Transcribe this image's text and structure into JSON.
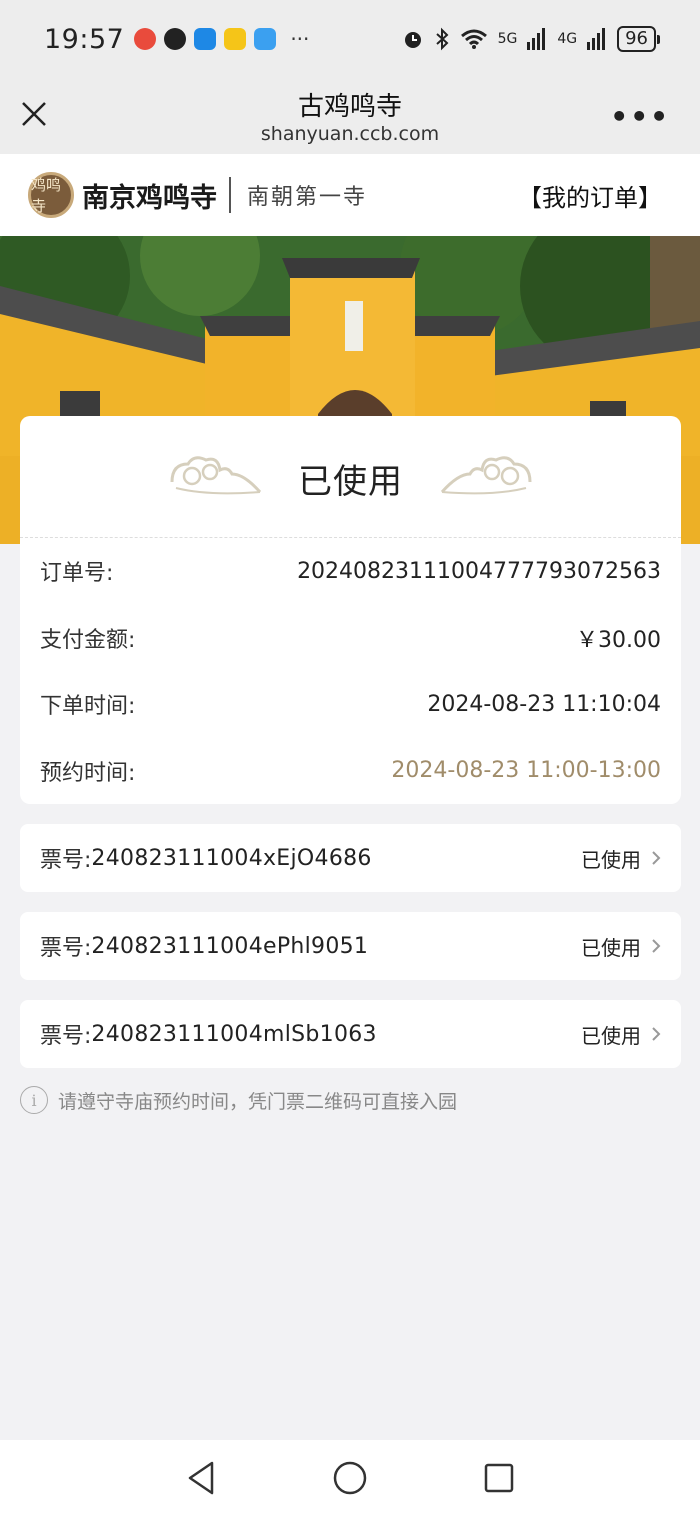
{
  "status_bar": {
    "time": "19:57",
    "more": "···",
    "network_5g": "5G",
    "network_4g": "4G",
    "battery": "96"
  },
  "browser": {
    "title": "古鸡鸣寺",
    "url": "shanyuan.ccb.com"
  },
  "site_header": {
    "logo_text": "鸡鸣寺",
    "brand": "南京鸡鸣寺",
    "slogan": "南朝第一寺",
    "my_orders": "【我的订单】"
  },
  "order": {
    "status": "已使用",
    "rows": [
      {
        "label": "订单号:",
        "value": "20240823111004777793072563"
      },
      {
        "label": "支付金额:",
        "value": "￥30.00"
      },
      {
        "label": "下单时间:",
        "value": "2024-08-23 11:10:04"
      },
      {
        "label": "预约时间:",
        "value": "2024-08-23 11:00-13:00"
      }
    ]
  },
  "tickets": [
    {
      "prefix": "票号:",
      "number": "240823111004xEjO4686",
      "status": "已使用"
    },
    {
      "prefix": "票号:",
      "number": "240823111004ePhl9051",
      "status": "已使用"
    },
    {
      "prefix": "票号:",
      "number": "240823111004mlSb1063",
      "status": "已使用"
    }
  ],
  "notice": {
    "icon": "i",
    "text": "请遵守寺庙预约时间，凭门票二维码可直接入园"
  },
  "colors": {
    "accent_gold": "#a08c6a",
    "wall_yellow": "#f0b429"
  }
}
